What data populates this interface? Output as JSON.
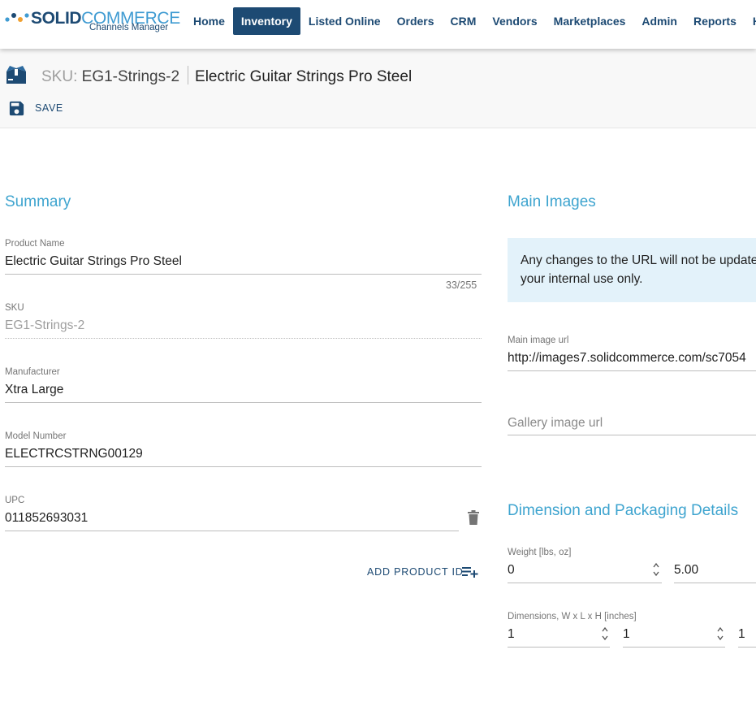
{
  "logo": {
    "brand_bold": "SOLID",
    "brand_light": "COMMERCE",
    "subtitle": "Channels Manager"
  },
  "nav": {
    "items": [
      {
        "label": "Home",
        "active": false
      },
      {
        "label": "Inventory",
        "active": true
      },
      {
        "label": "Listed Online",
        "active": false
      },
      {
        "label": "Orders",
        "active": false
      },
      {
        "label": "CRM",
        "active": false
      },
      {
        "label": "Vendors",
        "active": false
      },
      {
        "label": "Marketplaces",
        "active": false
      },
      {
        "label": "Admin",
        "active": false
      },
      {
        "label": "Reports",
        "active": false
      },
      {
        "label": "Help",
        "active": false
      }
    ]
  },
  "header": {
    "sku_label": "SKU:",
    "sku_value": "EG1-Strings-2",
    "product_title": "Electric Guitar Strings Pro Steel",
    "save_label": "SAVE"
  },
  "summary": {
    "title": "Summary",
    "product_name": {
      "label": "Product Name",
      "value": "Electric Guitar Strings Pro Steel",
      "counter": "33/255"
    },
    "sku": {
      "label": "SKU",
      "value": "EG1-Strings-2"
    },
    "manufacturer": {
      "label": "Manufacturer",
      "value": "Xtra Large"
    },
    "model_number": {
      "label": "Model Number",
      "value": "ELECTRCSTRNG00129"
    },
    "upc": {
      "label": "UPC",
      "value": "011852693031"
    },
    "add_product_id_label": "ADD PRODUCT ID"
  },
  "main_images": {
    "title": "Main Images",
    "notice_line1": "Any changes to the URL will not be update",
    "notice_line2": "your internal use only.",
    "main_image_url": {
      "label": "Main image url",
      "value": "http://images7.solidcommerce.com/sc7054"
    },
    "gallery_image_url": {
      "placeholder": "Gallery image url"
    }
  },
  "dimensions": {
    "title": "Dimension and Packaging Details",
    "weight": {
      "label": "Weight [lbs, oz]",
      "lbs": "0",
      "oz": "5.00"
    },
    "dimensions": {
      "label": "Dimensions, W x L x H [inches]",
      "w": "1",
      "l": "1",
      "h": "1"
    }
  },
  "colors": {
    "primary": "#1d4a73",
    "accent": "#3ea4cf",
    "info_bg": "#e3f2fa"
  }
}
